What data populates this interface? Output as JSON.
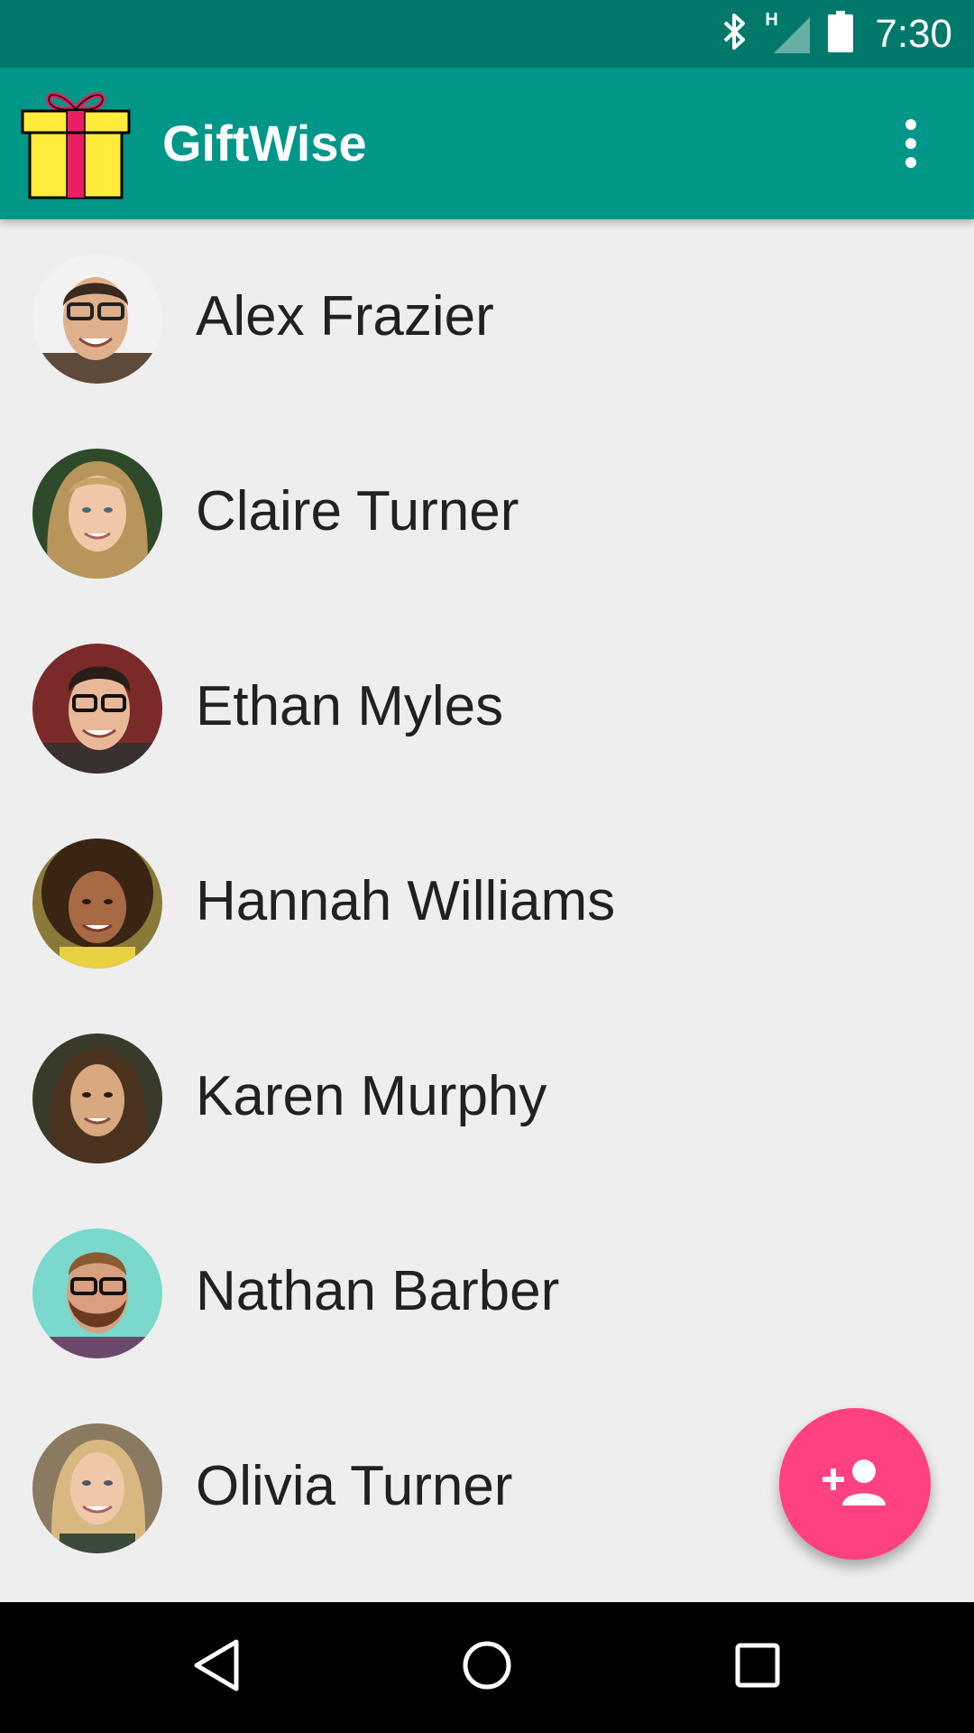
{
  "status_bar": {
    "time": "7:30",
    "network_label": "H",
    "icons": [
      "bluetooth-icon",
      "signal-icon",
      "battery-icon"
    ]
  },
  "app_bar": {
    "title": "GiftWise",
    "logo": "gift-icon",
    "menu_icon": "more-vert-icon"
  },
  "contacts": [
    {
      "name": "Alex Frazier"
    },
    {
      "name": "Claire Turner"
    },
    {
      "name": "Ethan Myles"
    },
    {
      "name": "Hannah Williams"
    },
    {
      "name": "Karen Murphy"
    },
    {
      "name": "Nathan Barber"
    },
    {
      "name": "Olivia Turner"
    }
  ],
  "fab": {
    "icon": "person-add-icon"
  },
  "nav_bar": {
    "icons": [
      "back-icon",
      "home-icon",
      "recents-icon"
    ]
  },
  "colors": {
    "status_bar": "#00796b",
    "app_bar": "#009688",
    "background": "#eeeeee",
    "accent": "#ff4081",
    "text": "#212121"
  }
}
